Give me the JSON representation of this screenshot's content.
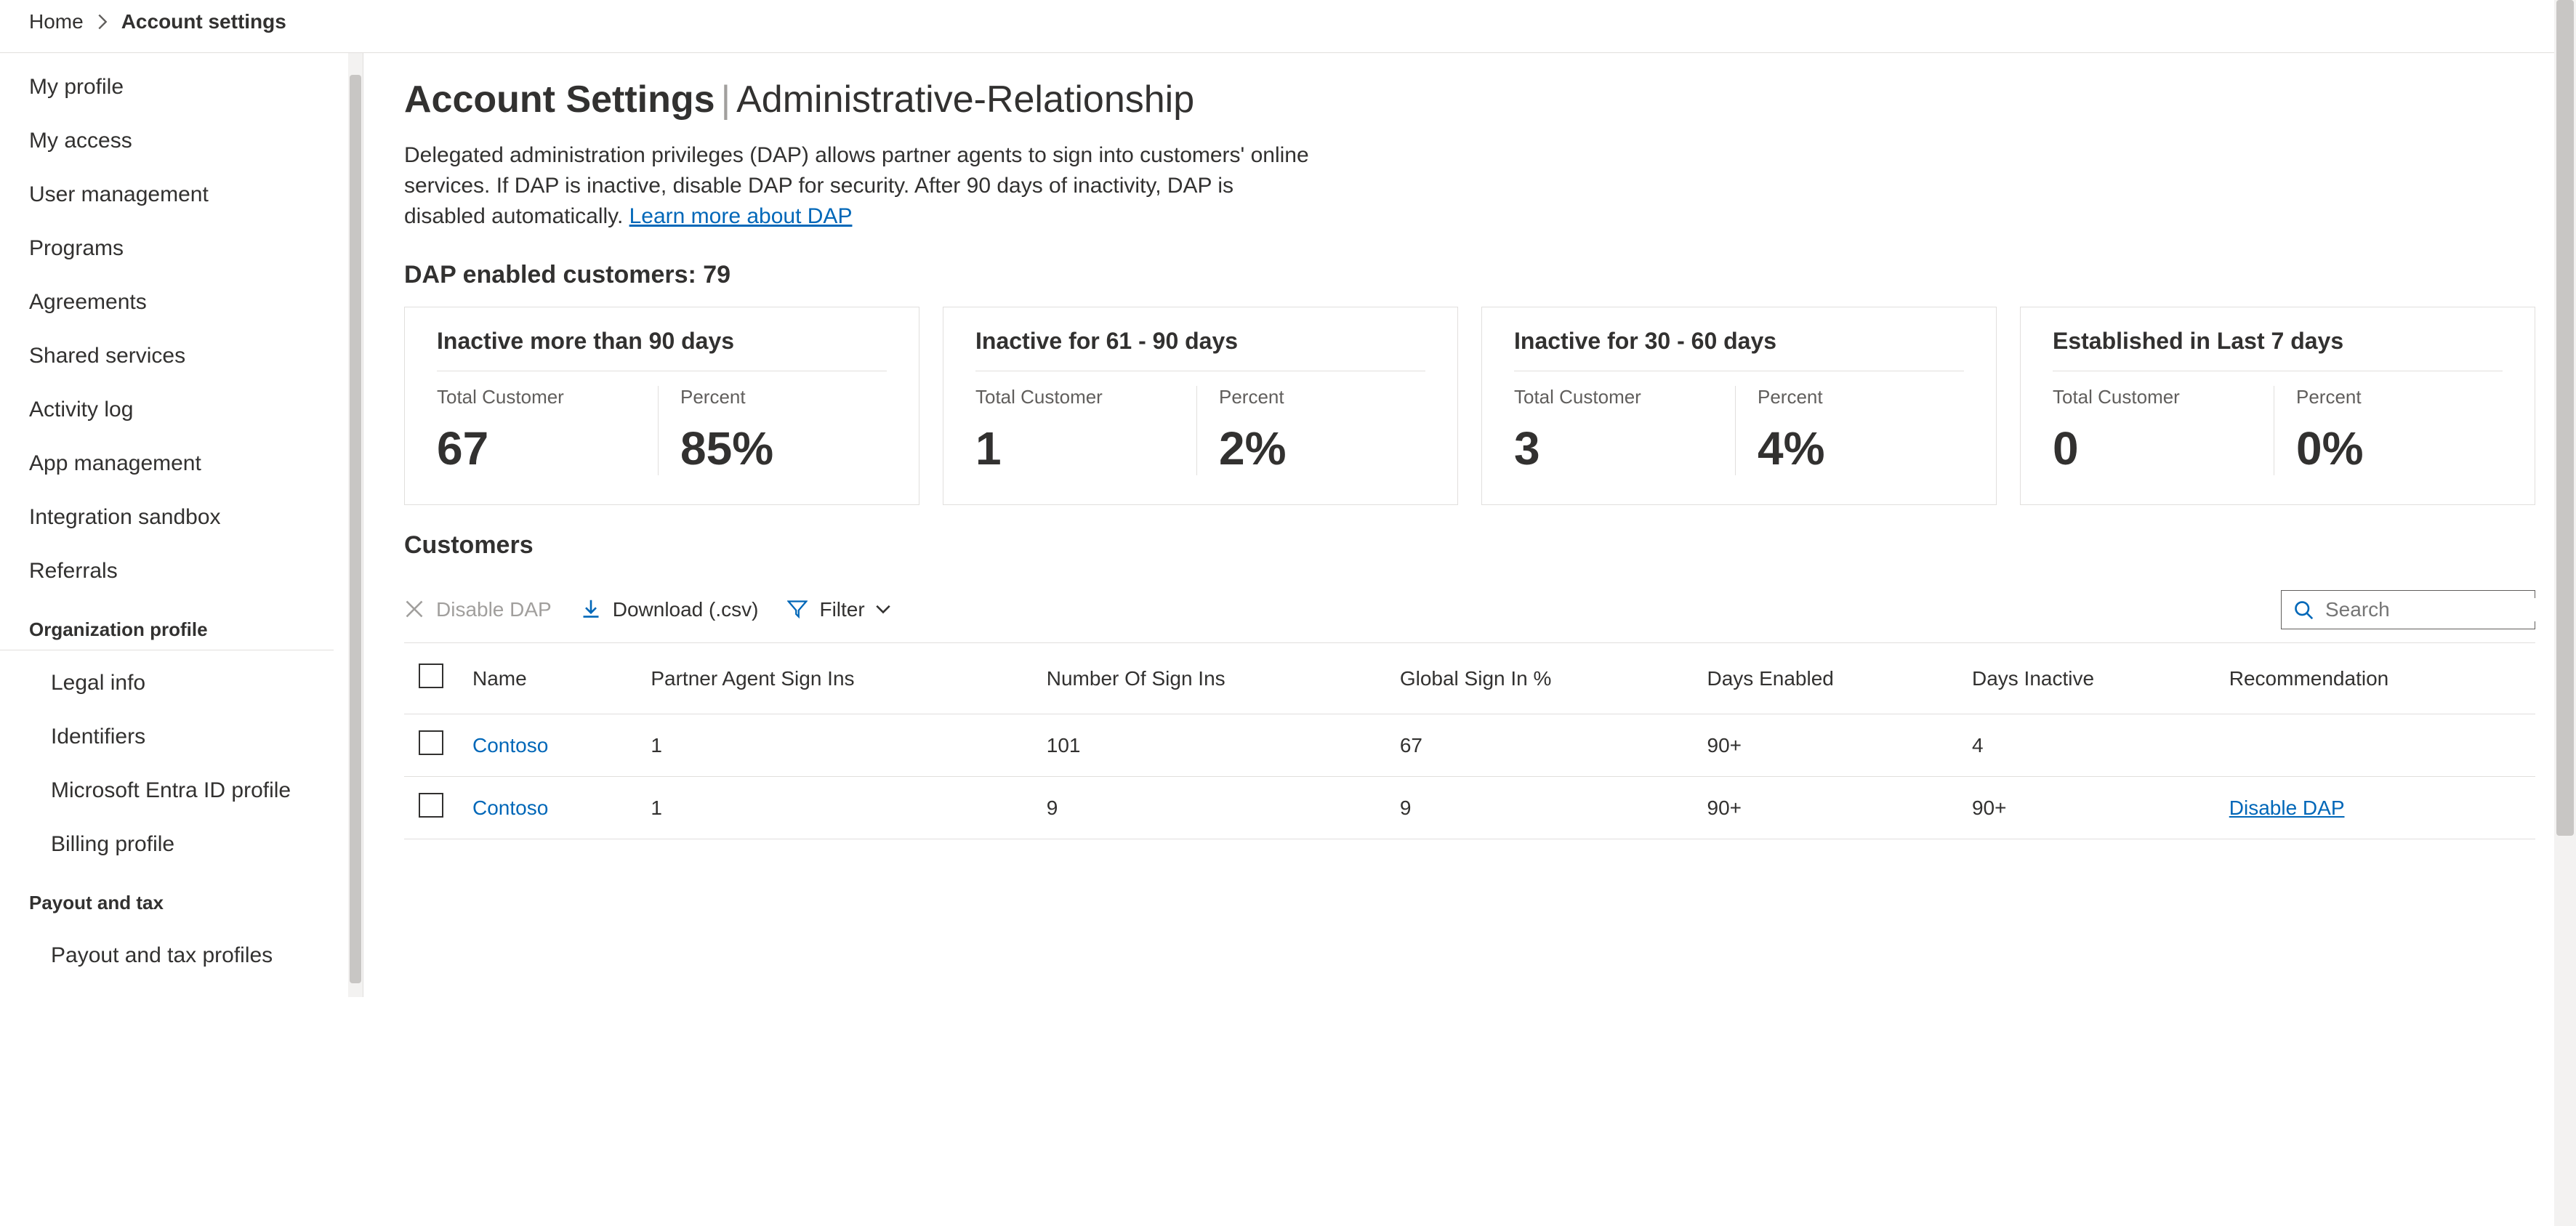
{
  "breadcrumb": {
    "home": "Home",
    "current": "Account settings"
  },
  "sidebar": {
    "items": [
      "My profile",
      "My access",
      "User management",
      "Programs",
      "Agreements",
      "Shared services",
      "Activity log",
      "App management",
      "Integration sandbox",
      "Referrals"
    ],
    "org_header": "Organization profile",
    "org_items": [
      "Legal info",
      "Identifiers",
      "Microsoft Entra ID profile",
      "Billing profile"
    ],
    "payout_header": "Payout and tax",
    "payout_items": [
      "Payout and tax profiles"
    ]
  },
  "page": {
    "title_strong": "Account Settings",
    "title_rest": "Administrative-Relationship",
    "description": "Delegated administration privileges (DAP) allows partner agents to sign into customers' online services. If DAP is inactive, disable DAP for security. After 90 days of inactivity, DAP is disabled automatically. ",
    "learn_more": "Learn more about DAP",
    "dap_heading": "DAP enabled customers: 79"
  },
  "cards": [
    {
      "title": "Inactive more than 90 days",
      "total_label": "Total Customer",
      "total": "67",
      "percent_label": "Percent",
      "percent": "85%"
    },
    {
      "title": "Inactive for 61 - 90 days",
      "total_label": "Total Customer",
      "total": "1",
      "percent_label": "Percent",
      "percent": "2%"
    },
    {
      "title": "Inactive for 30 - 60 days",
      "total_label": "Total Customer",
      "total": "3",
      "percent_label": "Percent",
      "percent": "4%"
    },
    {
      "title": "Established in Last 7 days",
      "total_label": "Total Customer",
      "total": "0",
      "percent_label": "Percent",
      "percent": "0%"
    }
  ],
  "customers_heading": "Customers",
  "toolbar": {
    "disable_dap": "Disable DAP",
    "download": "Download (.csv)",
    "filter": "Filter",
    "search_placeholder": "Search"
  },
  "table": {
    "headers": [
      "Name",
      "Partner Agent Sign Ins",
      "Number Of Sign Ins",
      "Global Sign In %",
      "Days Enabled",
      "Days Inactive",
      "Recommendation"
    ],
    "rows": [
      {
        "name": "Contoso",
        "partner_signins": "1",
        "num_signins": "101",
        "global_pct": "67",
        "days_enabled": "90+",
        "days_inactive": "4",
        "recommendation": ""
      },
      {
        "name": "Contoso",
        "partner_signins": "1",
        "num_signins": "9",
        "global_pct": "9",
        "days_enabled": "90+",
        "days_inactive": "90+",
        "recommendation": "Disable DAP"
      }
    ]
  }
}
